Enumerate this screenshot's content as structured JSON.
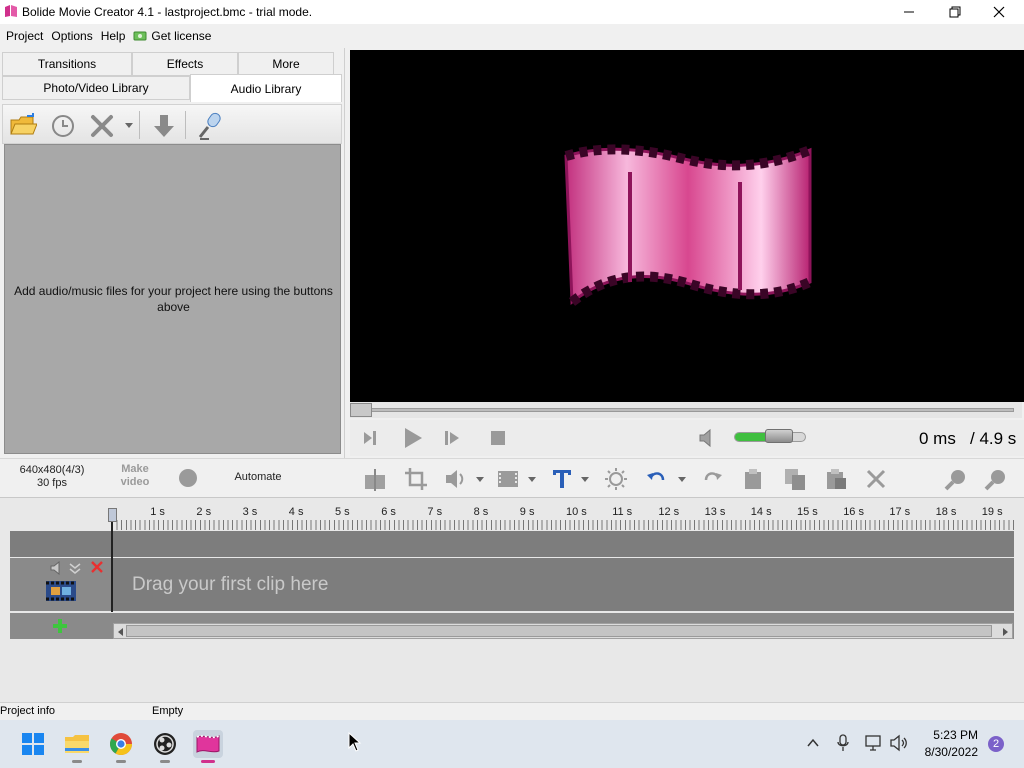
{
  "window": {
    "title": "Bolide Movie Creator 4.1 - lastproject.bmc - trial mode."
  },
  "menu": {
    "project": "Project",
    "options": "Options",
    "help": "Help",
    "get_license": "Get license"
  },
  "tabs": {
    "transitions": "Transitions",
    "effects": "Effects",
    "more": "More",
    "photo_video_library": "Photo/Video Library",
    "audio_library": "Audio Library"
  },
  "audio_library": {
    "hint": "Add audio/music files for your project here using the buttons above"
  },
  "player": {
    "time_current": "0 ms",
    "time_total": "/ 4.9 s",
    "volume_fraction": 0.6,
    "seek_fraction": 0.0
  },
  "project": {
    "resolution": "640x480(4/3)",
    "fps": "30 fps",
    "make_video_label": "Make\nvideo",
    "automate_label": "Automate"
  },
  "timeline": {
    "tick_labels": [
      "1 s",
      "2 s",
      "3 s",
      "4 s",
      "5 s",
      "6 s",
      "7 s",
      "8 s",
      "9 s",
      "10 s",
      "11 s",
      "12 s",
      "13 s",
      "14 s",
      "15 s",
      "16 s",
      "17 s",
      "18 s",
      "19 s"
    ],
    "drag_hint": "Drag your first clip here"
  },
  "statusbar": {
    "project_info": "Project info",
    "state": "Empty"
  },
  "taskbar": {
    "time": "5:23 PM",
    "date": "8/30/2022",
    "notifications": "2"
  },
  "colors": {
    "accent_pink": "#e0359c",
    "volume_green": "#3fbf3f",
    "timeline_track": "#7d7d7d"
  }
}
